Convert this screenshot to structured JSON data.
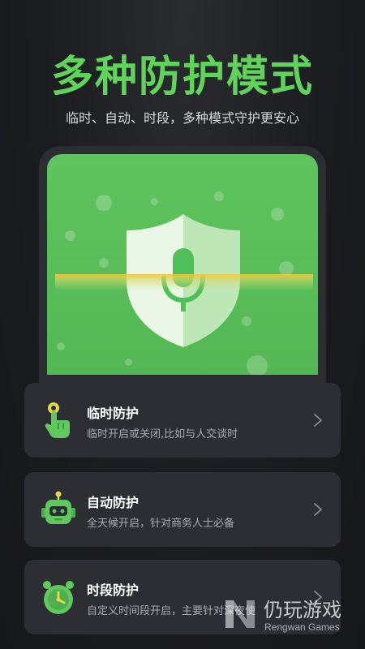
{
  "header": {
    "title": "多种防护模式",
    "subtitle": "临时、自动、时段，多种模式守护更安心"
  },
  "preview": {
    "icon": "shield-microphone-icon"
  },
  "modes": [
    {
      "title": "临时防护",
      "desc": "临时开启或关闭,比如与人交谈时",
      "icon": "tap-finger-icon"
    },
    {
      "title": "自动防护",
      "desc": "全天候开启，针对商务人士必备",
      "icon": "robot-icon"
    },
    {
      "title": "时段防护",
      "desc": "自定义时间段开启，主要针对深夜使",
      "icon": "clock-icon"
    }
  ],
  "watermark": {
    "cn": "仍玩游戏",
    "en": "Rengwan Games"
  },
  "colors": {
    "accent": "#5fd35a",
    "card_bg": "#2c2e33"
  }
}
